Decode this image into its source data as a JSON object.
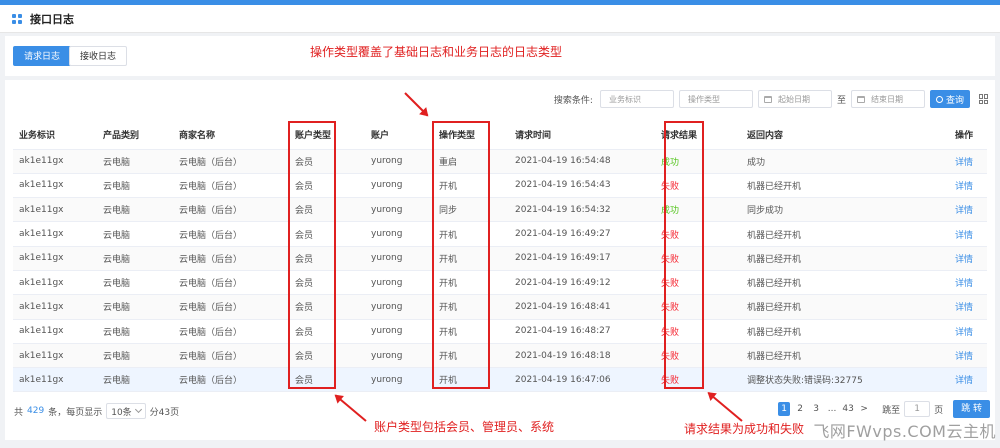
{
  "header": {
    "title": "接口日志"
  },
  "tabs": [
    {
      "label": "请求日志",
      "active": true
    },
    {
      "label": "接收日志",
      "active": false
    }
  ],
  "annotations": {
    "top_note": "操作类型覆盖了基础日志和业务日志的日志类型",
    "account_note": "账户类型包括会员、管理员、系统",
    "result_note": "请求结果为成功和失败"
  },
  "search": {
    "label": "搜索条件:",
    "business_id_placeholder": "业务标识",
    "op_type_placeholder": "操作类型",
    "start_date_placeholder": "起始日期",
    "range_sep": "至",
    "end_date_placeholder": "结束日期",
    "query_label": "查询"
  },
  "table": {
    "columns": [
      "业务标识",
      "产品类别",
      "商家名称",
      "账户类型",
      "账户",
      "操作类型",
      "请求时间",
      "请求结果",
      "返回内容",
      "操作"
    ],
    "rows": [
      {
        "business_id": "ak1e11gx",
        "product": "云电脑",
        "merchant": "云电脑（后台）",
        "account_type": "会员",
        "account": "yurong",
        "op_type": "重启",
        "time": "2021-04-19 16:54:48",
        "result": "成功",
        "result_ok": true,
        "response": "成功",
        "action": "详情"
      },
      {
        "business_id": "ak1e11gx",
        "product": "云电脑",
        "merchant": "云电脑（后台）",
        "account_type": "会员",
        "account": "yurong",
        "op_type": "开机",
        "time": "2021-04-19 16:54:43",
        "result": "失败",
        "result_ok": false,
        "response": "机器已经开机",
        "action": "详情"
      },
      {
        "business_id": "ak1e11gx",
        "product": "云电脑",
        "merchant": "云电脑（后台）",
        "account_type": "会员",
        "account": "yurong",
        "op_type": "同步",
        "time": "2021-04-19 16:54:32",
        "result": "成功",
        "result_ok": true,
        "response": "同步成功",
        "action": "详情"
      },
      {
        "business_id": "ak1e11gx",
        "product": "云电脑",
        "merchant": "云电脑（后台）",
        "account_type": "会员",
        "account": "yurong",
        "op_type": "开机",
        "time": "2021-04-19 16:49:27",
        "result": "失败",
        "result_ok": false,
        "response": "机器已经开机",
        "action": "详情"
      },
      {
        "business_id": "ak1e11gx",
        "product": "云电脑",
        "merchant": "云电脑（后台）",
        "account_type": "会员",
        "account": "yurong",
        "op_type": "开机",
        "time": "2021-04-19 16:49:17",
        "result": "失败",
        "result_ok": false,
        "response": "机器已经开机",
        "action": "详情"
      },
      {
        "business_id": "ak1e11gx",
        "product": "云电脑",
        "merchant": "云电脑（后台）",
        "account_type": "会员",
        "account": "yurong",
        "op_type": "开机",
        "time": "2021-04-19 16:49:12",
        "result": "失败",
        "result_ok": false,
        "response": "机器已经开机",
        "action": "详情"
      },
      {
        "business_id": "ak1e11gx",
        "product": "云电脑",
        "merchant": "云电脑（后台）",
        "account_type": "会员",
        "account": "yurong",
        "op_type": "开机",
        "time": "2021-04-19 16:48:41",
        "result": "失败",
        "result_ok": false,
        "response": "机器已经开机",
        "action": "详情"
      },
      {
        "business_id": "ak1e11gx",
        "product": "云电脑",
        "merchant": "云电脑（后台）",
        "account_type": "会员",
        "account": "yurong",
        "op_type": "开机",
        "time": "2021-04-19 16:48:27",
        "result": "失败",
        "result_ok": false,
        "response": "机器已经开机",
        "action": "详情"
      },
      {
        "business_id": "ak1e11gx",
        "product": "云电脑",
        "merchant": "云电脑（后台）",
        "account_type": "会员",
        "account": "yurong",
        "op_type": "开机",
        "time": "2021-04-19 16:48:18",
        "result": "失败",
        "result_ok": false,
        "response": "机器已经开机",
        "action": "详情"
      },
      {
        "business_id": "ak1e11gx",
        "product": "云电脑",
        "merchant": "云电脑（后台）",
        "account_type": "会员",
        "account": "yurong",
        "op_type": "开机",
        "time": "2021-04-19 16:47:06",
        "result": "失败",
        "result_ok": false,
        "response": "调整状态失败:错误码:32775",
        "action": "详情"
      }
    ]
  },
  "footer": {
    "total_prefix": "共",
    "total": "429",
    "total_suffix": "条，每页显示",
    "page_size": "10条",
    "pages_text": "分43页"
  },
  "pager": {
    "pages": [
      "1",
      "2",
      "3",
      "...",
      "43"
    ],
    "current": "1",
    "next": ">",
    "jump_label": "跳至",
    "jump_value": "1",
    "jump_unit": "页",
    "jump_button": "跳 转"
  },
  "watermark": "飞网FWvps.COM云主机",
  "colors": {
    "accent": "#3a8ee6",
    "success": "#52c41a",
    "fail": "#f5222d",
    "annotation": "#e02020"
  }
}
